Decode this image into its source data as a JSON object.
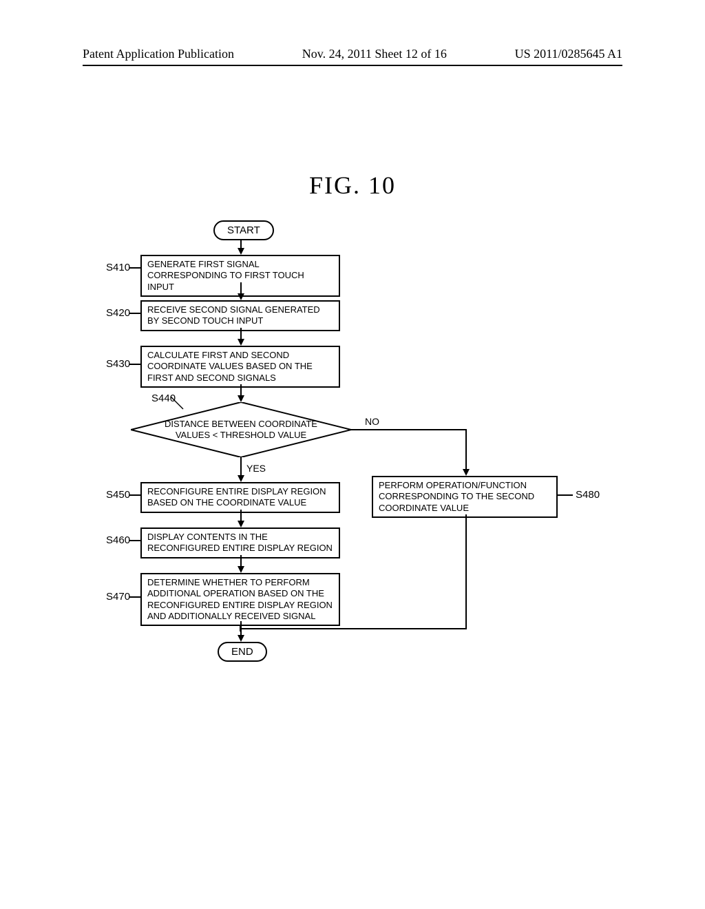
{
  "header": {
    "left": "Patent Application Publication",
    "center": "Nov. 24, 2011  Sheet 12 of 16",
    "right": "US 2011/0285645 A1"
  },
  "figure": {
    "title": "FIG.  10"
  },
  "flow": {
    "start": "START",
    "end": "END",
    "yes": "YES",
    "no": "NO",
    "s410": {
      "label": "S410",
      "text": "GENERATE FIRST SIGNAL CORRESPONDING TO FIRST TOUCH INPUT"
    },
    "s420": {
      "label": "S420",
      "text": "RECEIVE SECOND SIGNAL GENERATED BY SECOND TOUCH INPUT"
    },
    "s430": {
      "label": "S430",
      "text": "CALCULATE FIRST AND SECOND COORDINATE VALUES BASED ON THE FIRST AND SECOND SIGNALS"
    },
    "s440": {
      "label": "S440",
      "text": "DISTANCE BETWEEN COORDINATE VALUES < THRESHOLD VALUE"
    },
    "s450": {
      "label": "S450",
      "text": "RECONFIGURE ENTIRE DISPLAY REGION BASED ON THE COORDINATE VALUE"
    },
    "s460": {
      "label": "S460",
      "text": "DISPLAY CONTENTS IN THE RECONFIGURED ENTIRE DISPLAY REGION"
    },
    "s470": {
      "label": "S470",
      "text": "DETERMINE WHETHER TO PERFORM ADDITIONAL OPERATION BASED ON THE RECONFIGURED ENTIRE DISPLAY REGION AND ADDITIONALLY RECEIVED SIGNAL"
    },
    "s480": {
      "label": "S480",
      "text": "PERFORM OPERATION/FUNCTION CORRESPONDING TO THE SECOND COORDINATE VALUE"
    }
  }
}
